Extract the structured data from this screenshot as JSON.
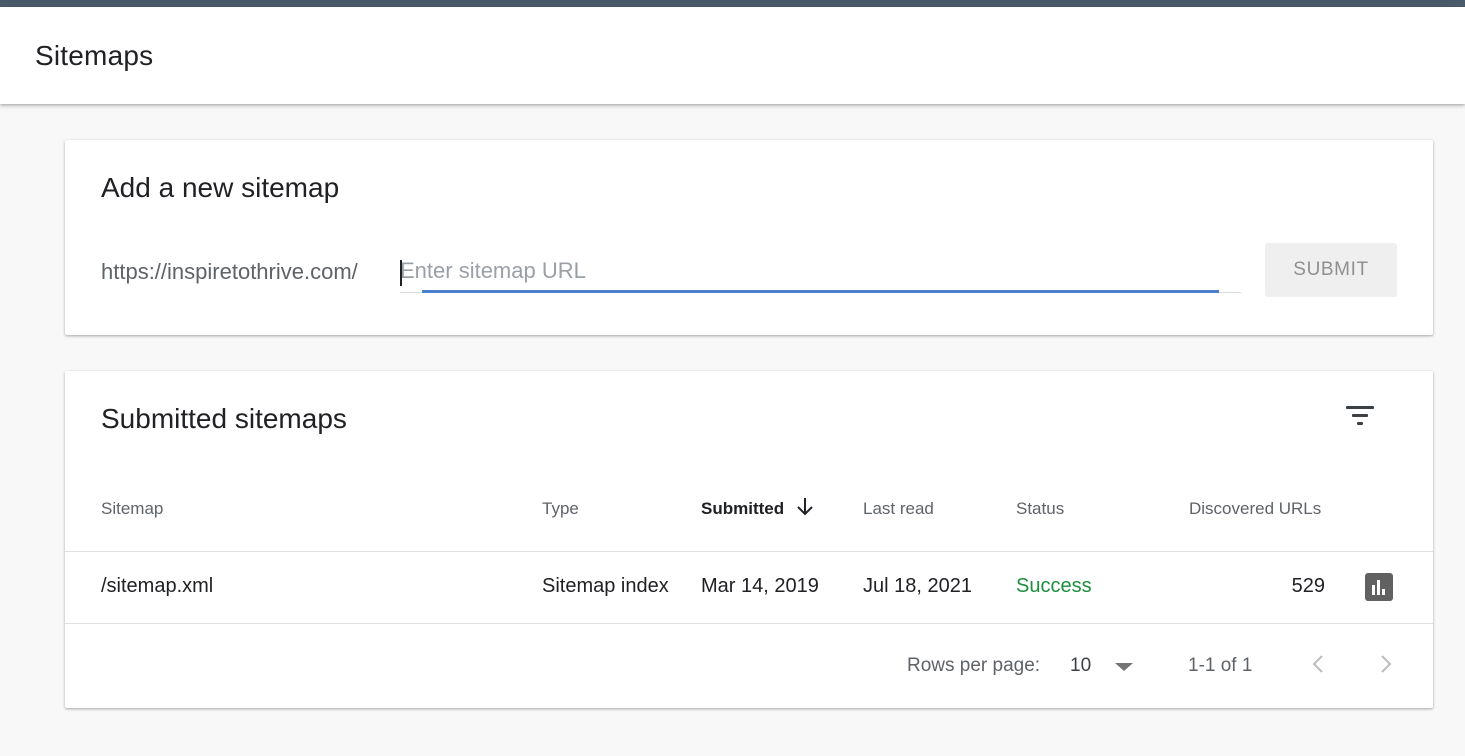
{
  "header": {
    "title": "Sitemaps"
  },
  "add_sitemap": {
    "title": "Add a new sitemap",
    "url_prefix": "https://inspiretothrive.com/",
    "input_value": "",
    "input_placeholder": "Enter sitemap URL",
    "submit_label": "SUBMIT"
  },
  "submitted_sitemaps": {
    "title": "Submitted sitemaps",
    "filter_icon": "filter-list-icon",
    "columns": {
      "sitemap": "Sitemap",
      "type": "Type",
      "submitted": "Submitted",
      "last_read": "Last read",
      "status": "Status",
      "discovered_urls": "Discovered URLs"
    },
    "sorted_column": "submitted",
    "sort_direction": "descending",
    "rows": [
      {
        "sitemap": "/sitemap.xml",
        "type": "Sitemap index",
        "submitted": "Mar 14, 2019",
        "last_read": "Jul 18, 2021",
        "status": "Success",
        "discovered_urls": "529",
        "action_icon": "bar-chart-icon"
      }
    ],
    "pagination": {
      "rows_per_page_label": "Rows per page:",
      "rows_per_page_value": "10",
      "range": "1-1 of 1"
    }
  },
  "colors": {
    "top_strip": "#4b5a69",
    "accent_blue": "#4a7fd0",
    "status_success": "#1e8e3e",
    "background": "#f8f8f8"
  }
}
